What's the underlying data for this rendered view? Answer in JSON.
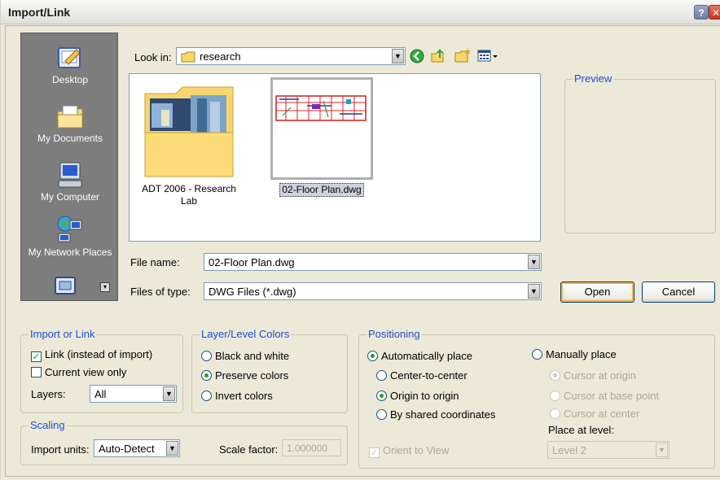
{
  "window": {
    "title": "Import/Link",
    "help_glyph": "?",
    "close_glyph": "✕"
  },
  "places": [
    {
      "label": "Desktop",
      "icon": "desktop-icon"
    },
    {
      "label": "My Documents",
      "icon": "my-documents-icon"
    },
    {
      "label": "My Computer",
      "icon": "my-computer-icon"
    },
    {
      "label": "My Network Places",
      "icon": "my-network-places-icon"
    }
  ],
  "lookin": {
    "label": "Look in:",
    "value": "research"
  },
  "files": [
    {
      "name_line1": "ADT 2006 - Research",
      "name_line2": "Lab",
      "type": "folder"
    },
    {
      "name_line1": "02-Floor Plan.dwg",
      "name_line2": "",
      "type": "dwg-thumbnail"
    }
  ],
  "preview": {
    "label": "Preview"
  },
  "filename": {
    "label": "File name:",
    "value": "02-Floor Plan.dwg"
  },
  "filetype": {
    "label": "Files of type:",
    "value": "DWG Files (*.dwg)"
  },
  "buttons": {
    "open": "Open",
    "cancel": "Cancel"
  },
  "import_or_link": {
    "title": "Import or Link",
    "link_label": "Link (instead of import)",
    "current_view_label": "Current view only",
    "layers_label": "Layers:",
    "layers_value": "All"
  },
  "layer_colors": {
    "title": "Layer/Level Colors",
    "black_white": "Black and white",
    "preserve": "Preserve colors",
    "invert": "Invert colors"
  },
  "scaling": {
    "title": "Scaling",
    "import_units_label": "Import units:",
    "import_units_value": "Auto-Detect",
    "scale_factor_label": "Scale factor:",
    "scale_factor_value": "1.000000"
  },
  "positioning": {
    "title": "Positioning",
    "auto_place": "Automatically place",
    "center_to_center": "Center-to-center",
    "origin_to_origin": "Origin to origin",
    "shared_coords": "By shared coordinates",
    "manual_place": "Manually place",
    "cursor_origin": "Cursor at origin",
    "cursor_base": "Cursor at base point",
    "cursor_center": "Cursor at center",
    "place_at_level_label": "Place at level:",
    "place_at_level_value": "Level 2",
    "orient_to_view": "Orient to View"
  },
  "colors": {
    "accent_blue": "#1a4ed8",
    "places_bg": "#7d7d7d",
    "dialog_bg": "#ece9d8"
  }
}
